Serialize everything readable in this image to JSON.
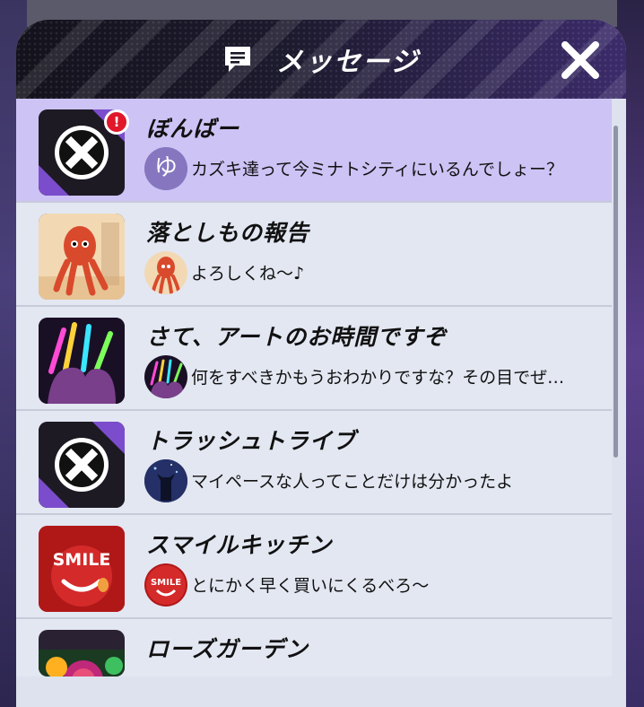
{
  "header": {
    "title": "メッセージ",
    "icon": "message-icon",
    "close_icon": "close-icon"
  },
  "threads": [
    {
      "name": "ぼんばー",
      "preview": "カズキ達って今ミナトシティにいるんでしょー？",
      "avatar_letter": "ゆ",
      "unread_badge": "!",
      "selected": true,
      "thumb": "bomber-x-logo",
      "avatar": "letter-avatar"
    },
    {
      "name": "落としもの報告",
      "preview": "よろしくね～♪",
      "selected": false,
      "thumb": "octopus-sausage",
      "avatar": "octopus-avatar"
    },
    {
      "name": "さて、アートのお時間ですぞ",
      "preview": "何をすべきかもうおわかりですな？その目でぜ…",
      "selected": false,
      "thumb": "glowstick-hands",
      "avatar": "glowstick-avatar"
    },
    {
      "name": "トラッシュトライブ",
      "preview": "マイペースな人ってことだけは分かったよ",
      "selected": false,
      "thumb": "trash-x-logo",
      "avatar": "cat-avatar"
    },
    {
      "name": "スマイルキッチン",
      "preview": "とにかく早く買いにくるべろ～",
      "selected": false,
      "thumb": "smile-logo",
      "avatar": "smile-avatar"
    },
    {
      "name": "ローズガーデン",
      "preview": "",
      "selected": false,
      "thumb": "rose-image",
      "avatar": ""
    }
  ],
  "thumb_smile_text": "SMILE",
  "colors": {
    "selected_row": "#cdc3f5",
    "row": "#e3e7f2",
    "badge": "#e0182a",
    "header_accent": "#3b2b6a"
  }
}
